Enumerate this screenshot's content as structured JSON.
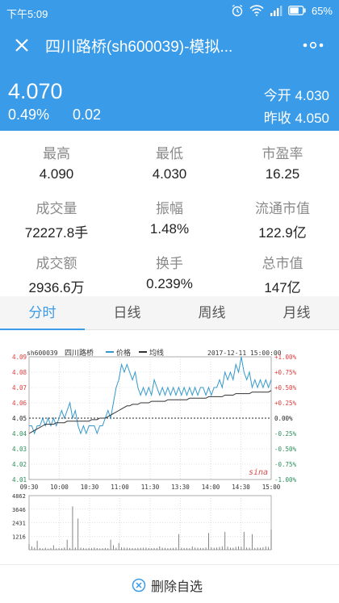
{
  "status": {
    "time": "下午5:09",
    "battery": "65%"
  },
  "header": {
    "title": "四川路桥(sh600039)-模拟..."
  },
  "quote": {
    "price": "4.070",
    "pct": "0.49%",
    "change": "0.02",
    "open": "今开 4.030",
    "prev_close": "昨收 4.050"
  },
  "stats": [
    {
      "label": "最高",
      "value": "4.090"
    },
    {
      "label": "最低",
      "value": "4.030"
    },
    {
      "label": "市盈率",
      "value": "16.25"
    },
    {
      "label": "成交量",
      "value": "72227.8手"
    },
    {
      "label": "振幅",
      "value": "1.48%"
    },
    {
      "label": "流通市值",
      "value": "122.9亿"
    },
    {
      "label": "成交额",
      "value": "2936.6万"
    },
    {
      "label": "换手",
      "value": "0.239%"
    },
    {
      "label": "总市值",
      "value": "147亿"
    }
  ],
  "tabs": [
    {
      "label": "分时",
      "active": true
    },
    {
      "label": "日线",
      "active": false
    },
    {
      "label": "周线",
      "active": false
    },
    {
      "label": "月线",
      "active": false
    }
  ],
  "chart_data": {
    "type": "line",
    "code_label": "sh600039",
    "name_label": "四川路桥",
    "legend": [
      {
        "name": "价格",
        "color": "#3399cc"
      },
      {
        "name": "均线",
        "color": "#333333"
      }
    ],
    "timestamp": "2017-12-11 15:00:00",
    "watermark": "sina",
    "ylim": [
      4.01,
      4.09
    ],
    "prev_close": 4.05,
    "y_ticks_left": [
      "4.09",
      "4.08",
      "4.07",
      "4.06",
      "4.05",
      "4.04",
      "4.03",
      "4.02",
      "4.01"
    ],
    "y_ticks_right": [
      "+1.00%",
      "+0.75%",
      "+0.50%",
      "+0.25%",
      "0.00%",
      "-0.25%",
      "-0.50%",
      "-0.75%",
      "-1.00%"
    ],
    "x_ticks": [
      "09:30",
      "10:00",
      "10:30",
      "11:00",
      "11:30",
      "13:30",
      "14:00",
      "14:30",
      "15:00"
    ],
    "price": [
      4.045,
      4.045,
      4.04,
      4.045,
      4.045,
      4.05,
      4.045,
      4.05,
      4.045,
      4.05,
      4.045,
      4.05,
      4.055,
      4.05,
      4.055,
      4.06,
      4.05,
      4.055,
      4.045,
      4.04,
      4.045,
      4.04,
      4.045,
      4.045,
      4.045,
      4.04,
      4.045,
      4.045,
      4.05,
      4.055,
      4.05,
      4.06,
      4.07,
      4.075,
      4.085,
      4.08,
      4.085,
      4.08,
      4.075,
      4.08,
      4.07,
      4.065,
      4.07,
      4.065,
      4.07,
      4.065,
      4.075,
      4.07,
      4.065,
      4.07,
      4.065,
      4.07,
      4.065,
      4.07,
      4.065,
      4.07,
      4.065,
      4.07,
      4.065,
      4.07,
      4.065,
      4.07,
      4.065,
      4.07,
      4.07,
      4.065,
      4.07,
      4.065,
      4.07,
      4.07,
      4.075,
      4.07,
      4.08,
      4.075,
      4.08,
      4.075,
      4.085,
      4.08,
      4.09,
      4.08,
      4.075,
      4.08,
      4.07,
      4.075,
      4.07,
      4.075,
      4.07,
      4.075,
      4.07,
      4.075
    ],
    "avg": [
      4.04,
      4.041,
      4.042,
      4.043,
      4.044,
      4.045,
      4.046,
      4.046,
      4.046,
      4.046,
      4.047,
      4.047,
      4.047,
      4.047,
      4.048,
      4.048,
      4.048,
      4.048,
      4.048,
      4.048,
      4.048,
      4.048,
      4.048,
      4.049,
      4.049,
      4.049,
      4.05,
      4.05,
      4.05,
      4.051,
      4.052,
      4.053,
      4.054,
      4.055,
      4.056,
      4.057,
      4.058,
      4.058,
      4.059,
      4.059,
      4.059,
      4.06,
      4.06,
      4.06,
      4.06,
      4.061,
      4.061,
      4.061,
      4.061,
      4.061,
      4.061,
      4.062,
      4.062,
      4.062,
      4.062,
      4.062,
      4.062,
      4.062,
      4.062,
      4.063,
      4.063,
      4.063,
      4.063,
      4.063,
      4.063,
      4.063,
      4.064,
      4.064,
      4.064,
      4.064,
      4.064,
      4.064,
      4.065,
      4.065,
      4.065,
      4.065,
      4.066,
      4.066,
      4.066,
      4.066,
      4.066,
      4.066,
      4.067,
      4.067,
      4.067,
      4.067,
      4.067,
      4.067,
      4.067,
      4.068
    ],
    "volume_ticks": [
      "4862",
      "3646",
      "2431",
      "1216"
    ],
    "volume_ylim": [
      0,
      4862
    ],
    "volume": [
      500,
      300,
      200,
      800,
      150,
      120,
      180,
      100,
      150,
      400,
      120,
      150,
      130,
      200,
      900,
      150,
      3900,
      200,
      2800,
      180,
      150,
      120,
      160,
      140,
      200,
      150,
      120,
      140,
      160,
      130,
      900,
      400,
      180,
      600,
      220,
      200,
      180,
      160,
      150,
      140,
      160,
      170,
      180,
      200,
      150,
      140,
      160,
      150,
      300,
      180,
      160,
      140,
      150,
      170,
      200,
      1400,
      180,
      160,
      150,
      140,
      300,
      200,
      180,
      160,
      150,
      200,
      1500,
      220,
      180,
      200,
      250,
      300,
      1600,
      280,
      200,
      180,
      250,
      300,
      260,
      1600,
      200,
      180,
      1400,
      160,
      200,
      180,
      220,
      300,
      250,
      1800
    ]
  },
  "bottom": {
    "delete_label": "删除自选"
  }
}
